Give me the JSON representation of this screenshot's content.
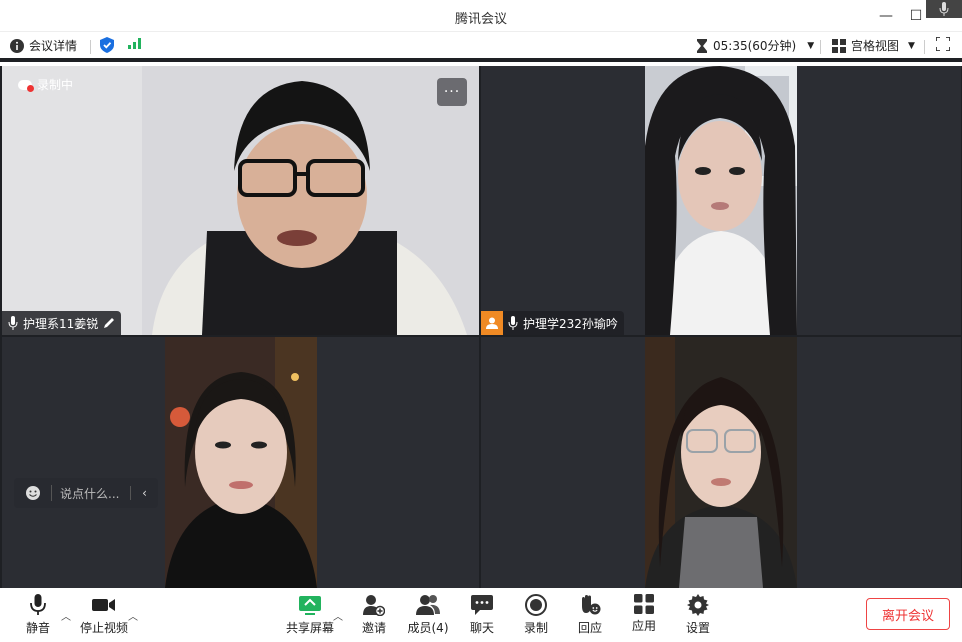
{
  "window": {
    "title": "腾讯会议"
  },
  "infobar": {
    "meeting_details": "会议详情",
    "timer": "05:35(60分钟)",
    "view_mode": "宫格视图"
  },
  "tiles": [
    {
      "name": "护理系11姜锐",
      "recording_label": "录制中",
      "more": "···"
    },
    {
      "name": "护理学232孙瑜吟"
    },
    {
      "chat_placeholder": "说点什么...",
      "chat_toggle": "‹"
    },
    {}
  ],
  "toolbar": {
    "mute": "静音",
    "stop_video": "停止视频",
    "share_screen": "共享屏幕",
    "invite": "邀请",
    "members": "成员(4)",
    "chat": "聊天",
    "record": "录制",
    "react": "回应",
    "apps": "应用",
    "settings": "设置",
    "leave": "离开会议"
  },
  "colors": {
    "accent_green": "#22b35e",
    "danger_red": "#e33",
    "shield_blue": "#1a6fe0",
    "tile_bg": "#2b2d33",
    "grid_bg": "#1e2024"
  }
}
